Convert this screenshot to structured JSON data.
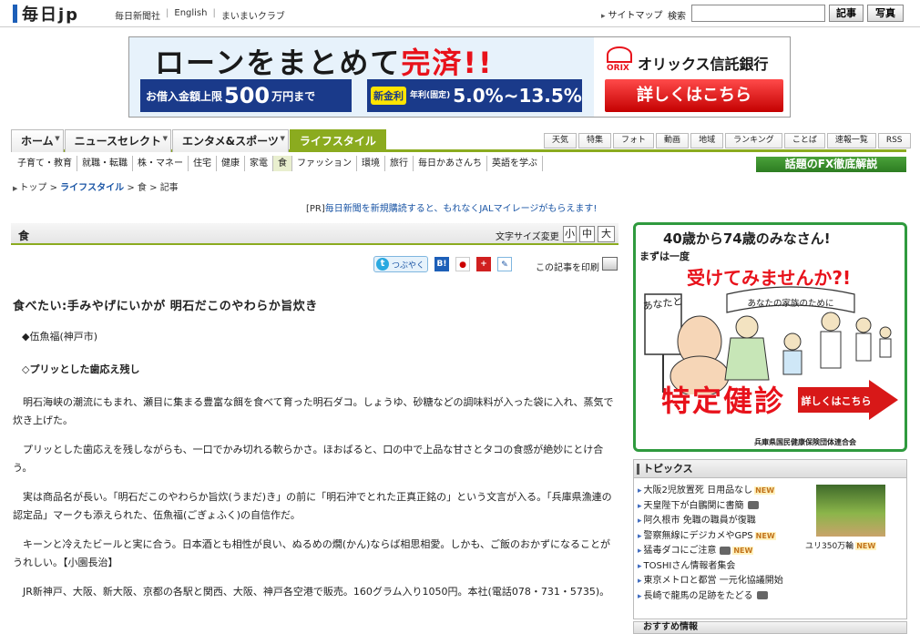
{
  "header": {
    "logo": "毎日jp",
    "links": [
      "毎日新聞社",
      "English",
      "まいまいクラブ"
    ],
    "sitemap": "サイトマップ",
    "search_label": "検索",
    "search_value": "",
    "btn_article": "記事",
    "btn_photo": "写真"
  },
  "banner_ad": {
    "headline_black": "ローンをまとめて",
    "headline_red": "完済!!",
    "limit_prefix": "お借入金額上限",
    "limit_value": "500",
    "limit_suffix": "万円まで",
    "rate_badge": "新金利",
    "rate_note": "年利(固定)",
    "rate_range": "5.0%~13.5%",
    "brand_logo": "ORIX",
    "brand_name": "オリックス信託銀行",
    "cta": "詳しくはこちら"
  },
  "main_nav": [
    {
      "label": "ホーム",
      "active": false
    },
    {
      "label": "ニュースセレクト",
      "active": false
    },
    {
      "label": "エンタメ&スポーツ",
      "active": false
    },
    {
      "label": "ライフスタイル",
      "active": true
    }
  ],
  "sub_nav_right": [
    "天気",
    "特集",
    "フォト",
    "動画",
    "地域",
    "ランキング",
    "ことば",
    "速報一覧",
    "RSS"
  ],
  "category_nav": [
    {
      "label": "子育て・教育",
      "active": false
    },
    {
      "label": "就職・転職",
      "active": false
    },
    {
      "label": "株・マネー",
      "active": false
    },
    {
      "label": "住宅",
      "active": false
    },
    {
      "label": "健康",
      "active": false
    },
    {
      "label": "家電",
      "active": false
    },
    {
      "label": "食",
      "active": true
    },
    {
      "label": "ファッション",
      "active": false
    },
    {
      "label": "環境",
      "active": false
    },
    {
      "label": "旅行",
      "active": false
    },
    {
      "label": "毎日かあさんち",
      "active": false
    },
    {
      "label": "英語を学ぶ",
      "active": false
    }
  ],
  "fx_banner": "話題のFX徹底解説",
  "breadcrumb": {
    "top": "トップ",
    "sep": ">",
    "section": "ライフスタイル",
    "category": "食",
    "current": "記事"
  },
  "pr": {
    "tag": "[PR]",
    "text": "毎日新聞を新規購読すると、もれなくJALマイレージがもらえます!"
  },
  "section": {
    "title": "食",
    "font_size_label": "文字サイズ変更",
    "font_small": "小",
    "font_medium": "中",
    "font_large": "大"
  },
  "share": {
    "tweet": "つぶやく",
    "hatena": "B!",
    "print_label": "この記事を印刷"
  },
  "article": {
    "title": "食べたい:手みやげにいかが 明石だこのやわらか旨炊き",
    "shop": "◆伍魚福(神戸市)",
    "subhead": "◇プリッとした歯応え残し",
    "paragraphs": [
      "明石海峡の潮流にもまれ、瀬目に集まる豊富な餌を食べて育った明石ダコ。しょうゆ、砂糖などの調味料が入った袋に入れ、蒸気で炊き上げた。",
      "プリッとした歯応えを残しながらも、一口でかみ切れる軟らかさ。ほおばると、口の中で上品な甘さとタコの食感が絶妙にとけ合う。",
      "実は商品名が長い。「明石だこのやわらか旨炊(うまだ)き」の前に「明石沖でとれた正真正銘の」という文言が入る。「兵庫県漁連の認定品」マークも添えられた、伍魚福(ごぎょふく)の自信作だ。",
      "キーンと冷えたビールと実に合う。日本酒とも相性が良い、ぬるめの燗(かん)ならば相思相愛。しかも、ご飯のおかずになることがうれしい。【小園長治】",
      "JR新神戸、大阪、新大阪、京都の各駅と関西、大阪、神戸各空港で販売。160グラム入り1050円。本社(電話078・731・5735)。"
    ]
  },
  "right_ad": {
    "line1": "40歳から74歳のみなさん!",
    "line2": "まずは一度",
    "line3": "受けてみませんか?!",
    "sign_left": "あなたと",
    "sign_right": "あなたの家族のために",
    "kanji": "特定健診",
    "cta": "詳しくはこちら",
    "footer": "兵庫県国民健康保険団体連合会"
  },
  "topics": {
    "title": "トピックス",
    "items": [
      {
        "text": "大阪2児放置死 日用品なし",
        "new": true,
        "photo": false
      },
      {
        "text": "天皇陛下が白鵬関に書簡",
        "new": false,
        "photo": true
      },
      {
        "text": "阿久根市 免職の職員が復職",
        "new": false,
        "photo": false
      },
      {
        "text": "警察無線にデジカメやGPS",
        "new": true,
        "photo": false
      },
      {
        "text": "猛毒ダコにご注意",
        "new": true,
        "photo": true
      },
      {
        "text": "TOSHIさん情報者集会",
        "new": false,
        "photo": false
      },
      {
        "text": "東京メトロと都営 一元化協議開始",
        "new": false,
        "photo": false
      },
      {
        "text": "長崎で龍馬の足跡をたどる",
        "new": false,
        "photo": true
      }
    ],
    "new_label": "NEW",
    "photo_caption": "ユリ350万輪",
    "photo_new": "NEW"
  },
  "recommend": {
    "title": "おすすめ情報"
  }
}
